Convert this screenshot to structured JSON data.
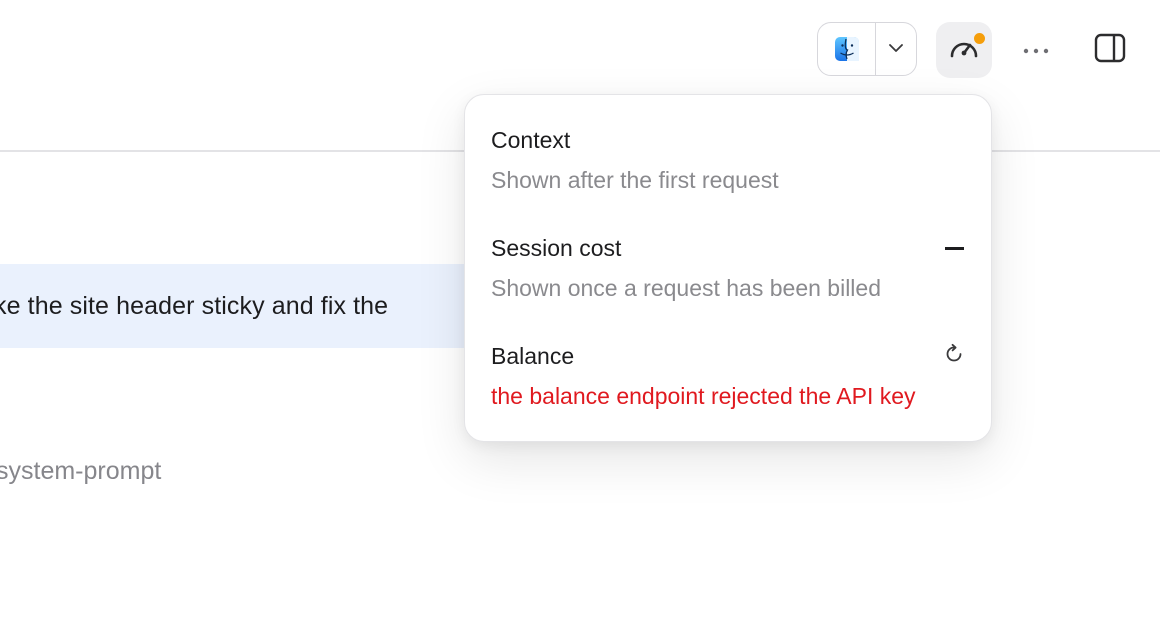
{
  "toolbar": {
    "app_picker": {
      "icon": "finder-icon",
      "caret_icon": "chevron-down-icon"
    },
    "usage_button": {
      "icon": "gauge-icon",
      "status_dot_color": "#f59e0b"
    },
    "more_button": {
      "icon": "ellipsis-icon"
    },
    "panel_toggle": {
      "icon": "sidebar-right-icon"
    }
  },
  "chat": {
    "user_message": "ke the site header sticky and fix the",
    "system_prompt_label": "system-prompt"
  },
  "usage_popover": {
    "context": {
      "title": "Context",
      "subtitle": "Shown after the first request"
    },
    "session_cost": {
      "title": "Session cost",
      "value": "—",
      "subtitle": "Shown once a request has been billed"
    },
    "balance": {
      "title": "Balance",
      "refresh_icon": "refresh-icon",
      "error": "the balance endpoint rejected the API key",
      "error_color": "#e0191f"
    }
  }
}
